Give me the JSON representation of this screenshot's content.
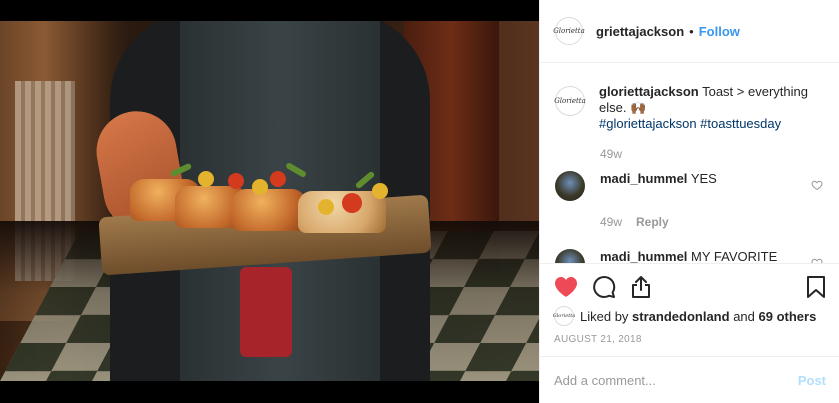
{
  "post": {
    "author": "griettajackson",
    "follow_label": "Follow",
    "separator": "•",
    "avatar_text": "Glorietta",
    "caption": {
      "username": "gloriettajackson",
      "text": "Toast > everything else. 🙌🏾",
      "hashtags": "#gloriettajackson #toasttuesday",
      "time": "49w"
    },
    "comments": [
      {
        "username": "madi_hummel",
        "text": "YES",
        "time": "49w",
        "reply": "Reply"
      },
      {
        "username": "madi_hummel",
        "text": "MY FAVORITE"
      }
    ],
    "liked_by": {
      "prefix": "Liked by",
      "user": "strandedonland",
      "connector": "and",
      "others": "69 others"
    },
    "date": "AUGUST 21, 2018",
    "add_comment_placeholder": "Add a comment...",
    "post_label": "Post"
  },
  "icons": {
    "like": "heart-icon",
    "comment": "comment-icon",
    "share": "share-icon",
    "save": "bookmark-icon"
  },
  "colors": {
    "accent": "#3897f0",
    "liked": "#ed4956",
    "post_disabled": "#b2dffc"
  }
}
